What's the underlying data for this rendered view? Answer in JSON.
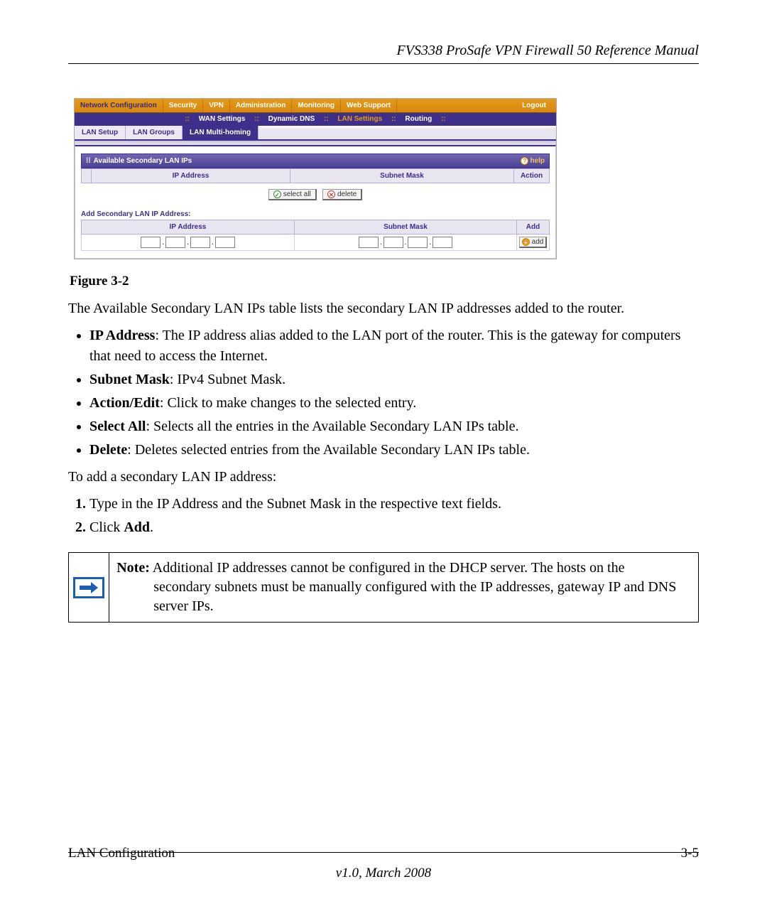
{
  "doc": {
    "header_title": "FVS338 ProSafe VPN Firewall 50 Reference Manual",
    "figure_caption": "Figure 3-2",
    "para_intro": "The Available Secondary LAN IPs table lists the secondary LAN IP addresses added to the router.",
    "bullets": [
      {
        "b": "IP Address",
        "rest": ": The IP address alias added to the LAN port of the router. This is the gateway for computers that need to access the Internet."
      },
      {
        "b": "Subnet Mask",
        "rest": ": IPv4 Subnet Mask."
      },
      {
        "b": "Action/Edit",
        "rest": ": Click to make changes to the selected entry."
      },
      {
        "b": "Select All",
        "rest": ": Selects all the entries in the Available Secondary LAN IPs table."
      },
      {
        "b": "Delete",
        "rest": ": Deletes selected entries from the Available Secondary LAN IPs table."
      }
    ],
    "para_toadd": "To add a secondary LAN IP address:",
    "steps": [
      "Type in the IP Address and the Subnet Mask in the respective text fields.",
      "Click Add."
    ],
    "note_label": "Note:",
    "note_text_line1": " Additional IP addresses cannot be configured in the DHCP server. The hosts on the",
    "note_text_line2": "secondary subnets must be manually configured with the IP addresses, gateway IP and DNS server IPs.",
    "footer_left": "LAN Configuration",
    "footer_right": "3-5",
    "footer_center": "v1.0, March 2008"
  },
  "ui": {
    "topnav": [
      "Network Configuration",
      "Security",
      "VPN",
      "Administration",
      "Monitoring",
      "Web Support",
      "Logout"
    ],
    "topnav_active_index": 0,
    "subnav": [
      "WAN Settings",
      "Dynamic DNS",
      "LAN Settings",
      "Routing"
    ],
    "subnav_active_index": 2,
    "tabs": [
      "LAN Setup",
      "LAN Groups",
      "LAN Multi-homing"
    ],
    "tab_active_index": 2,
    "section_title": "Available Secondary LAN IPs",
    "help_label": "help",
    "cols": {
      "ip": "IP Address",
      "mask": "Subnet Mask",
      "action": "Action",
      "add": "Add"
    },
    "buttons": {
      "select_all": "select all",
      "delete": "delete",
      "add": "add"
    },
    "add_section_title": "Add Secondary LAN IP Address:"
  }
}
